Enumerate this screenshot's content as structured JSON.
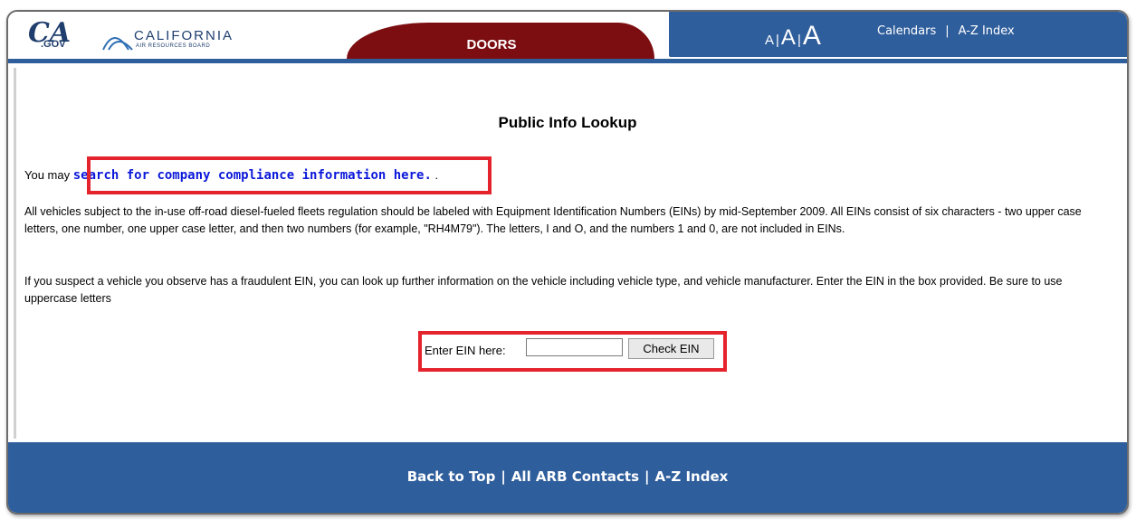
{
  "header": {
    "ca_logo_text": "CA",
    "ca_logo_sub": ".GOV",
    "arb_name": "CALIFORNIA",
    "arb_sub": "AIR RESOURCES BOARD",
    "active_tab": "DOORS",
    "font_small": "A",
    "font_medium": "A",
    "font_large": "A",
    "font_sep": "|",
    "links": {
      "calendars": "Calendars",
      "az_index": "A-Z Index",
      "separator": "|"
    }
  },
  "main": {
    "title": "Public Info Lookup",
    "intro_prefix": "You may",
    "intro_link": "search for company compliance information here.",
    "intro_suffix": ".",
    "paragraph1": "All vehicles subject to the in-use off-road diesel-fueled fleets regulation should be labeled with Equipment Identification Numbers (EINs) by mid-September 2009. All EINs consist of six characters - two upper case letters, one number, one upper case letter, and then two numbers (for example, \"RH4M79\"). The letters, I and O, and the numbers 1 and 0, are not included in EINs.",
    "paragraph2": "If you suspect a vehicle you observe has a fraudulent EIN, you can look up further information on the vehicle including vehicle type, and vehicle manufacturer. Enter the EIN in the box provided. Be sure to use uppercase letters",
    "ein_label": "Enter EIN here:",
    "ein_value": "",
    "ein_button": "Check EIN"
  },
  "footer": {
    "back_to_top": "Back to Top",
    "contacts": "All ARB Contacts",
    "az_index": "A-Z Index",
    "separator": "|"
  },
  "colors": {
    "brand_blue": "#2f5e9c",
    "tab_red": "#7c0e12",
    "highlight_red": "#e4232d",
    "link_blue": "#0b18d9"
  }
}
